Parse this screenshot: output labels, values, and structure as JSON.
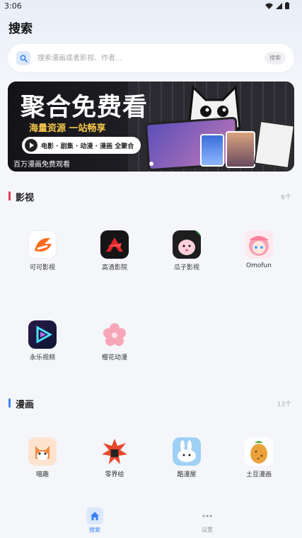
{
  "status_bar": {
    "time": "3:06"
  },
  "header": {
    "title": "搜索"
  },
  "search": {
    "placeholder": "搜索漫画或者影视、作者...",
    "button_label": "搜索"
  },
  "banner": {
    "headline": "聚合免费看",
    "subline": "海量资源 一站畅享",
    "pill_text": "电影 · 剧集 · 动漫 · 漫画 全聚合",
    "caption": "百万漫画免费观看"
  },
  "sections": [
    {
      "title": "影视",
      "count": "6个",
      "accent": "#e53950",
      "apps": [
        {
          "name": "可可影视",
          "icon": "keke-icon"
        },
        {
          "name": "高清影院",
          "icon": "gaoqing-icon"
        },
        {
          "name": "瓜子影视",
          "icon": "guazi-icon"
        },
        {
          "name": "Omofun",
          "icon": "omofun-icon"
        },
        {
          "name": "永乐视频",
          "icon": "yongle-icon"
        },
        {
          "name": "樱花动漫",
          "icon": "sakura-icon"
        }
      ]
    },
    {
      "title": "漫画",
      "count": "13个",
      "accent": "#3b82f6",
      "apps": [
        {
          "name": "喵趣",
          "icon": "miaoqu-icon"
        },
        {
          "name": "零界绘",
          "icon": "lingjiehui-icon"
        },
        {
          "name": "酷漫屋",
          "icon": "kumanwu-icon"
        },
        {
          "name": "土豆漫画",
          "icon": "tudou-icon"
        }
      ]
    }
  ],
  "tabs": [
    {
      "label": "搜索",
      "icon": "home-icon",
      "active": true
    },
    {
      "label": "设置",
      "icon": "more-icon",
      "active": false
    }
  ],
  "colors": {
    "accent": "#3b82f6",
    "video_accent": "#e53950"
  }
}
